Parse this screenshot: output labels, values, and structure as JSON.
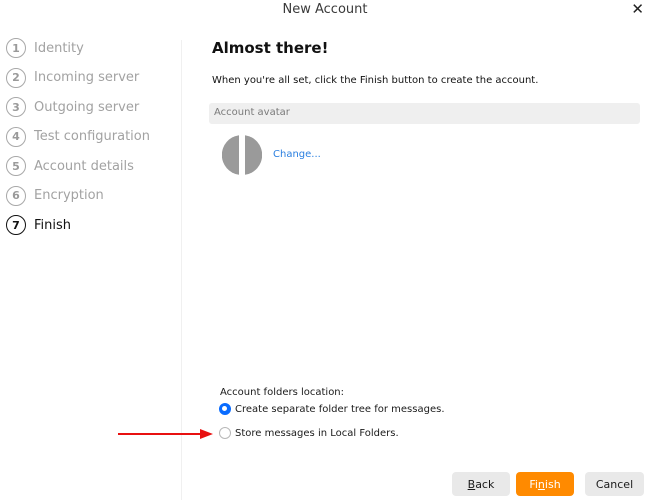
{
  "window": {
    "title": "New Account",
    "close_icon": "close-icon"
  },
  "sidebar": {
    "steps": [
      {
        "number": "1",
        "label": "Identity",
        "active": false
      },
      {
        "number": "2",
        "label": "Incoming server",
        "active": false
      },
      {
        "number": "3",
        "label": "Outgoing server",
        "active": false
      },
      {
        "number": "4",
        "label": "Test configuration",
        "active": false
      },
      {
        "number": "5",
        "label": "Account details",
        "active": false
      },
      {
        "number": "6",
        "label": "Encryption",
        "active": false
      },
      {
        "number": "7",
        "label": "Finish",
        "active": true
      }
    ]
  },
  "main": {
    "heading": "Almost there!",
    "description": "When you're all set, click the Finish button to create the account.",
    "avatar_section_label": "Account avatar",
    "change_link": "Change...",
    "folders_label": "Account folders location:",
    "options": [
      {
        "label": "Create separate folder tree for messages.",
        "selected": true
      },
      {
        "label": "Store messages in Local Folders.",
        "selected": false
      }
    ],
    "annotation": "red-arrow-pointer",
    "annotation_color": "#e81010"
  },
  "footer": {
    "back": {
      "pre": "",
      "accel": "B",
      "post": "ack"
    },
    "finish": {
      "pre": "Fi",
      "accel": "n",
      "post": "ish"
    },
    "cancel": "Cancel",
    "finish_color": "#ff8a00"
  }
}
